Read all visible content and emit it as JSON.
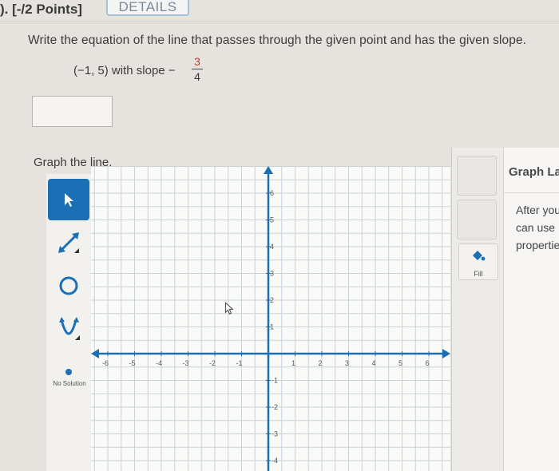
{
  "header": {
    "points": "). [-/2 Points]",
    "details_button": "DETAILS"
  },
  "question": {
    "prompt": "Write the equation of the line that passes through the given point and has the given slope.",
    "given_point": "(−1, 5) with slope  −",
    "slope_numerator": "3",
    "slope_denominator": "4",
    "answer_value": ""
  },
  "graph": {
    "label": "Graph the line.",
    "x_ticks": [
      "-6",
      "-5",
      "-4",
      "-3",
      "-2",
      "-1",
      "1",
      "2",
      "3",
      "4",
      "5",
      "6"
    ],
    "y_ticks": [
      "6",
      "5",
      "4",
      "3",
      "2",
      "1",
      "-1",
      "-2",
      "-3",
      "-4"
    ],
    "x_range": [
      -6,
      6
    ],
    "y_range": [
      -4,
      6
    ]
  },
  "tools": {
    "pointer": "pointer-icon",
    "line": "line-tool-icon",
    "circle": "circle-tool-icon",
    "parabola": "parabola-tool-icon",
    "point": "point-tool-icon",
    "no_solution": "No Solution"
  },
  "right_panel": {
    "fill_label": "Fill"
  },
  "side_card": {
    "title": "Graph La",
    "line1": "After you",
    "line2": "can use",
    "line3": "propertie"
  },
  "colors": {
    "accent": "#1a6fb5",
    "slope_numerator": "#c0392b",
    "grid": "#b8c8cf"
  }
}
